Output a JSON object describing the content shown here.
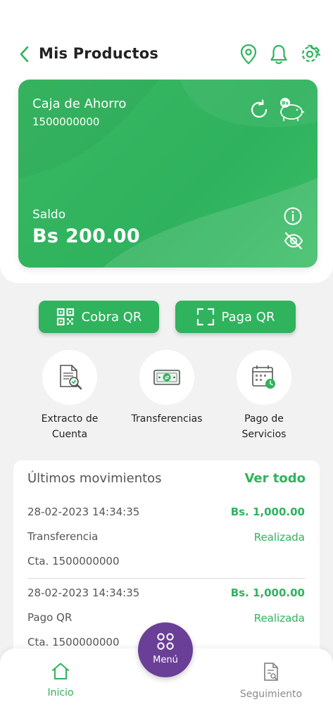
{
  "header": {
    "title": "Mis Productos",
    "icons": [
      "back-chevron-icon",
      "location-pin-icon",
      "bell-icon",
      "gear-icon"
    ]
  },
  "account_card": {
    "name": "Caja de Ahorro",
    "number": "1500000000",
    "balance_label": "Saldo",
    "balance": "Bs 200.00",
    "badge": "Bs",
    "icons": [
      "refresh-icon",
      "piggy-bank-icon",
      "info-icon",
      "eye-off-icon"
    ]
  },
  "qr_actions": {
    "cobra_label": "Cobra QR",
    "paga_label": "Paga QR"
  },
  "services": [
    {
      "line1": "Extracto de",
      "line2": "Cuenta",
      "icon": "statement-icon"
    },
    {
      "line1": "Transferencias",
      "line2": "",
      "icon": "money-transfer-icon"
    },
    {
      "line1": "Pago de",
      "line2": "Servicios",
      "icon": "calendar-clock-icon"
    }
  ],
  "movements": {
    "title": "Últimos movimientos",
    "view_all": "Ver todo",
    "items": [
      {
        "date": "28-02-2023 14:34:35",
        "amount": "Bs. 1,000.00",
        "type": "Transferencia",
        "status": "Realizada",
        "account": "Cta. 1500000000"
      },
      {
        "date": "28-02-2023 14:34:35",
        "amount": "Bs. 1,000.00",
        "type": "Pago QR",
        "status": "Realizada",
        "account": "Cta. 1500000000"
      }
    ]
  },
  "bottom_nav": {
    "home_label": "Inicio",
    "menu_label": "Menú",
    "tracking_label": "Seguimiento"
  },
  "colors": {
    "brand_green": "#2fb35d",
    "menu_purple": "#6a3f97",
    "background": "#f2f2f2"
  }
}
